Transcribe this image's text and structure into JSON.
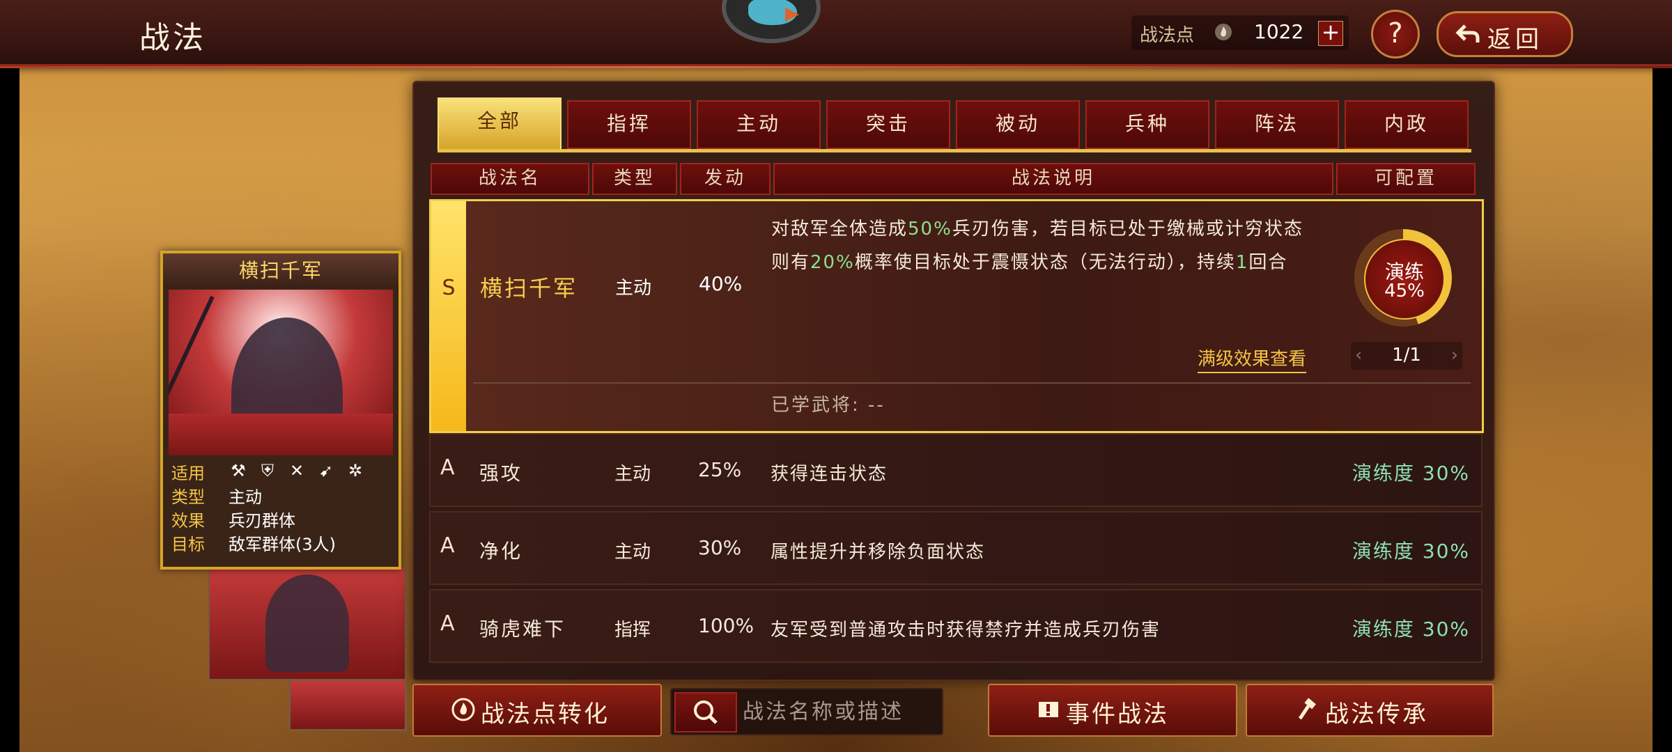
{
  "header": {
    "title": "战法",
    "points_label": "战法点",
    "points_value": "1022",
    "plus_label": "+",
    "help_label": "?",
    "back_label": "返回"
  },
  "card": {
    "name": "横扫千军",
    "rows": [
      {
        "key": "适用",
        "value": ""
      },
      {
        "key": "类型",
        "value": "主动"
      },
      {
        "key": "效果",
        "value": "兵刃群体"
      },
      {
        "key": "目标",
        "value": "敌军群体(3人)"
      }
    ],
    "unit_icons": [
      "axe-icon",
      "shield-icon",
      "crossed-bows-icon",
      "spear-icon",
      "wheel-icon"
    ]
  },
  "tabs": [
    "全部",
    "指挥",
    "主动",
    "突击",
    "被动",
    "兵种",
    "阵法",
    "内政"
  ],
  "active_tab": 0,
  "columns": [
    "战法名",
    "类型",
    "发动",
    "战法说明",
    "可配置"
  ],
  "selected": {
    "grade": "S",
    "name": "横扫千军",
    "type": "主动",
    "rate": "40%",
    "desc_parts": [
      {
        "t": "对敌军全体造成",
        "g": false
      },
      {
        "t": "50%",
        "g": true
      },
      {
        "t": "兵刃伤害，若目标已处于缴械或计穷状态则有",
        "g": false
      },
      {
        "t": "20%",
        "g": true
      },
      {
        "t": "概率使目标处于震慑状态（无法行动），持续",
        "g": false
      },
      {
        "t": "1",
        "g": true
      },
      {
        "t": "回合",
        "g": false
      }
    ],
    "practice_label": "演练",
    "practice_value": "45%",
    "practice_fraction": 0.45,
    "fullview_label": "满级效果查看",
    "page": "1/1",
    "learned_label": "已学武将:",
    "learned_value": "--"
  },
  "tactics": [
    {
      "grade": "A",
      "name": "强攻",
      "type": "主动",
      "rate": "25%",
      "desc": "获得连击状态",
      "progress": "演练度 30%"
    },
    {
      "grade": "A",
      "name": "净化",
      "type": "主动",
      "rate": "30%",
      "desc": "属性提升并移除负面状态",
      "progress": "演练度 30%"
    },
    {
      "grade": "A",
      "name": "骑虎难下",
      "type": "指挥",
      "rate": "100%",
      "desc": "友军受到普通攻击时获得禁疗并造成兵刃伤害",
      "progress": "演练度 30%"
    }
  ],
  "bottom": {
    "convert_label": "战法点转化",
    "search_placeholder": "战法名称或描述",
    "event_label": "事件战法",
    "inherit_label": "战法传承"
  }
}
